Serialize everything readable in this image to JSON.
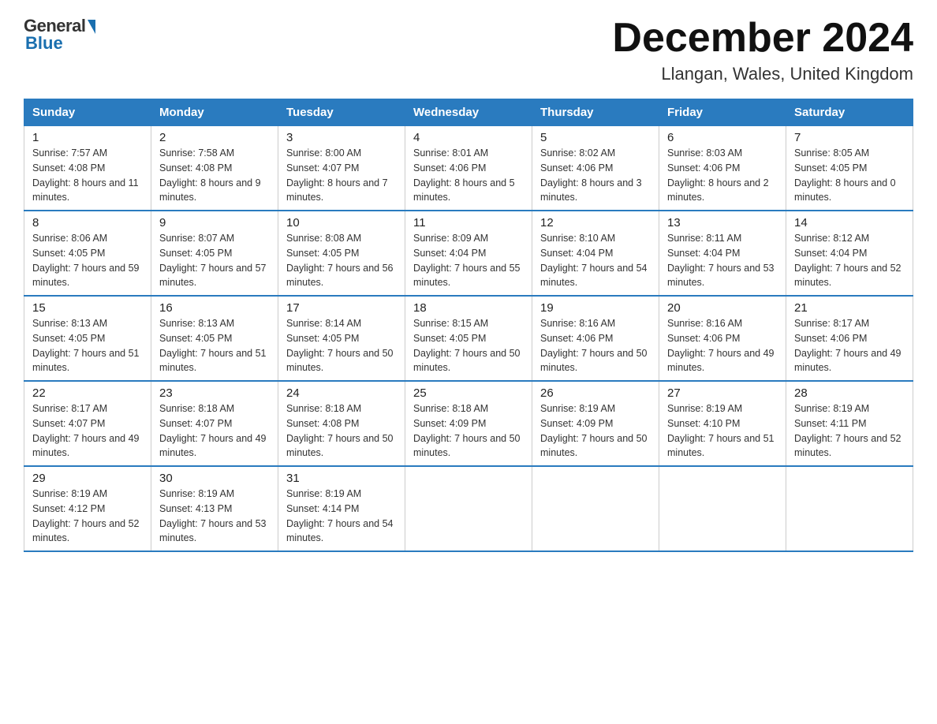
{
  "logo": {
    "general": "General",
    "blue": "Blue"
  },
  "title": "December 2024",
  "subtitle": "Llangan, Wales, United Kingdom",
  "days_header": [
    "Sunday",
    "Monday",
    "Tuesday",
    "Wednesday",
    "Thursday",
    "Friday",
    "Saturday"
  ],
  "weeks": [
    [
      {
        "num": "1",
        "sunrise": "7:57 AM",
        "sunset": "4:08 PM",
        "daylight": "8 hours and 11 minutes."
      },
      {
        "num": "2",
        "sunrise": "7:58 AM",
        "sunset": "4:08 PM",
        "daylight": "8 hours and 9 minutes."
      },
      {
        "num": "3",
        "sunrise": "8:00 AM",
        "sunset": "4:07 PM",
        "daylight": "8 hours and 7 minutes."
      },
      {
        "num": "4",
        "sunrise": "8:01 AM",
        "sunset": "4:06 PM",
        "daylight": "8 hours and 5 minutes."
      },
      {
        "num": "5",
        "sunrise": "8:02 AM",
        "sunset": "4:06 PM",
        "daylight": "8 hours and 3 minutes."
      },
      {
        "num": "6",
        "sunrise": "8:03 AM",
        "sunset": "4:06 PM",
        "daylight": "8 hours and 2 minutes."
      },
      {
        "num": "7",
        "sunrise": "8:05 AM",
        "sunset": "4:05 PM",
        "daylight": "8 hours and 0 minutes."
      }
    ],
    [
      {
        "num": "8",
        "sunrise": "8:06 AM",
        "sunset": "4:05 PM",
        "daylight": "7 hours and 59 minutes."
      },
      {
        "num": "9",
        "sunrise": "8:07 AM",
        "sunset": "4:05 PM",
        "daylight": "7 hours and 57 minutes."
      },
      {
        "num": "10",
        "sunrise": "8:08 AM",
        "sunset": "4:05 PM",
        "daylight": "7 hours and 56 minutes."
      },
      {
        "num": "11",
        "sunrise": "8:09 AM",
        "sunset": "4:04 PM",
        "daylight": "7 hours and 55 minutes."
      },
      {
        "num": "12",
        "sunrise": "8:10 AM",
        "sunset": "4:04 PM",
        "daylight": "7 hours and 54 minutes."
      },
      {
        "num": "13",
        "sunrise": "8:11 AM",
        "sunset": "4:04 PM",
        "daylight": "7 hours and 53 minutes."
      },
      {
        "num": "14",
        "sunrise": "8:12 AM",
        "sunset": "4:04 PM",
        "daylight": "7 hours and 52 minutes."
      }
    ],
    [
      {
        "num": "15",
        "sunrise": "8:13 AM",
        "sunset": "4:05 PM",
        "daylight": "7 hours and 51 minutes."
      },
      {
        "num": "16",
        "sunrise": "8:13 AM",
        "sunset": "4:05 PM",
        "daylight": "7 hours and 51 minutes."
      },
      {
        "num": "17",
        "sunrise": "8:14 AM",
        "sunset": "4:05 PM",
        "daylight": "7 hours and 50 minutes."
      },
      {
        "num": "18",
        "sunrise": "8:15 AM",
        "sunset": "4:05 PM",
        "daylight": "7 hours and 50 minutes."
      },
      {
        "num": "19",
        "sunrise": "8:16 AM",
        "sunset": "4:06 PM",
        "daylight": "7 hours and 50 minutes."
      },
      {
        "num": "20",
        "sunrise": "8:16 AM",
        "sunset": "4:06 PM",
        "daylight": "7 hours and 49 minutes."
      },
      {
        "num": "21",
        "sunrise": "8:17 AM",
        "sunset": "4:06 PM",
        "daylight": "7 hours and 49 minutes."
      }
    ],
    [
      {
        "num": "22",
        "sunrise": "8:17 AM",
        "sunset": "4:07 PM",
        "daylight": "7 hours and 49 minutes."
      },
      {
        "num": "23",
        "sunrise": "8:18 AM",
        "sunset": "4:07 PM",
        "daylight": "7 hours and 49 minutes."
      },
      {
        "num": "24",
        "sunrise": "8:18 AM",
        "sunset": "4:08 PM",
        "daylight": "7 hours and 50 minutes."
      },
      {
        "num": "25",
        "sunrise": "8:18 AM",
        "sunset": "4:09 PM",
        "daylight": "7 hours and 50 minutes."
      },
      {
        "num": "26",
        "sunrise": "8:19 AM",
        "sunset": "4:09 PM",
        "daylight": "7 hours and 50 minutes."
      },
      {
        "num": "27",
        "sunrise": "8:19 AM",
        "sunset": "4:10 PM",
        "daylight": "7 hours and 51 minutes."
      },
      {
        "num": "28",
        "sunrise": "8:19 AM",
        "sunset": "4:11 PM",
        "daylight": "7 hours and 52 minutes."
      }
    ],
    [
      {
        "num": "29",
        "sunrise": "8:19 AM",
        "sunset": "4:12 PM",
        "daylight": "7 hours and 52 minutes."
      },
      {
        "num": "30",
        "sunrise": "8:19 AM",
        "sunset": "4:13 PM",
        "daylight": "7 hours and 53 minutes."
      },
      {
        "num": "31",
        "sunrise": "8:19 AM",
        "sunset": "4:14 PM",
        "daylight": "7 hours and 54 minutes."
      },
      null,
      null,
      null,
      null
    ]
  ]
}
